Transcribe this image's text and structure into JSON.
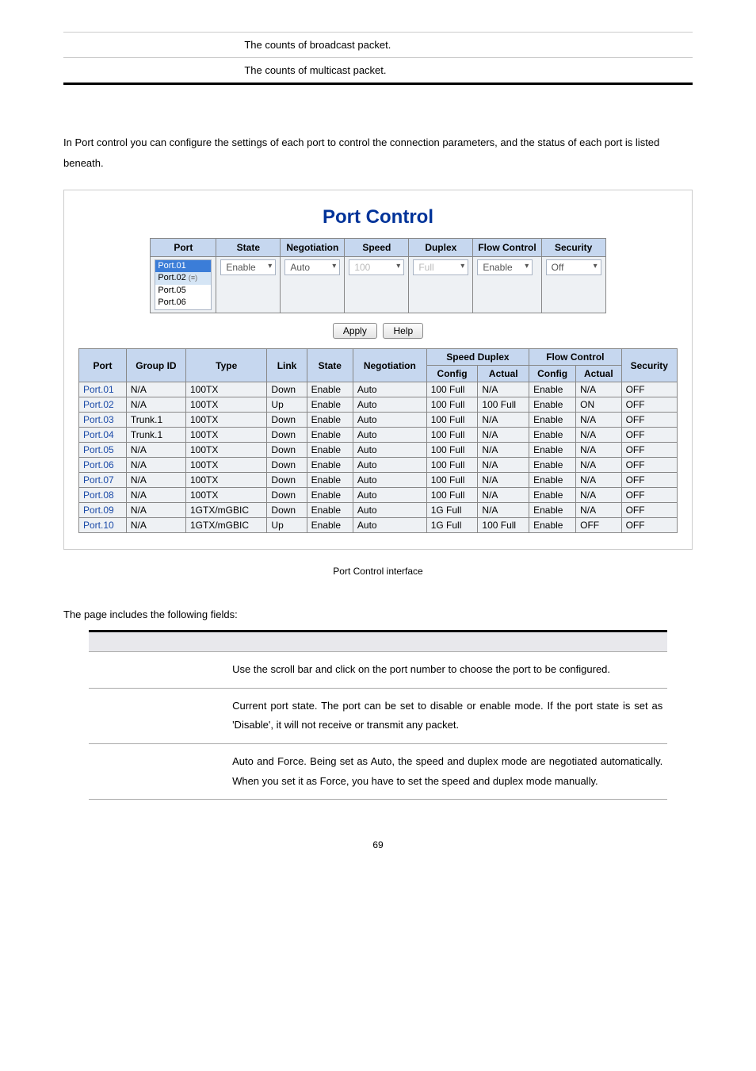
{
  "top_rows": [
    {
      "desc": "The counts of broadcast packet."
    },
    {
      "desc": "The counts of multicast packet."
    }
  ],
  "body_text": "In Port control you can configure the settings of each port to control the connection parameters, and the status of each port is listed beneath.",
  "screenshot": {
    "title": "Port Control",
    "control_headers": [
      "Port",
      "State",
      "Negotiation",
      "Speed",
      "Duplex",
      "Flow Control",
      "Security"
    ],
    "port_list": [
      "Port.01",
      "Port.02",
      "Port.05",
      "Port.06"
    ],
    "state_sel": "Enable",
    "neg_sel": "Auto",
    "speed_sel": "100",
    "duplex_sel": "Full",
    "flow_sel": "Enable",
    "sec_sel": "Off",
    "btn_apply": "Apply",
    "btn_help": "Help",
    "status_top_headers": {
      "port": "Port",
      "group": "Group ID",
      "type": "Type",
      "link": "Link",
      "state": "State",
      "neg": "Negotiation",
      "speed_duplex": "Speed Duplex",
      "flow": "Flow Control",
      "sec": "Security",
      "config": "Config",
      "actual": "Actual"
    },
    "status_rows": [
      {
        "port": "Port.01",
        "group": "N/A",
        "type": "100TX",
        "link": "Down",
        "state": "Enable",
        "neg": "Auto",
        "sd_cfg": "100 Full",
        "sd_act": "N/A",
        "fc_cfg": "Enable",
        "fc_act": "N/A",
        "sec": "OFF"
      },
      {
        "port": "Port.02",
        "group": "N/A",
        "type": "100TX",
        "link": "Up",
        "state": "Enable",
        "neg": "Auto",
        "sd_cfg": "100 Full",
        "sd_act": "100 Full",
        "fc_cfg": "Enable",
        "fc_act": "ON",
        "sec": "OFF"
      },
      {
        "port": "Port.03",
        "group": "Trunk.1",
        "type": "100TX",
        "link": "Down",
        "state": "Enable",
        "neg": "Auto",
        "sd_cfg": "100 Full",
        "sd_act": "N/A",
        "fc_cfg": "Enable",
        "fc_act": "N/A",
        "sec": "OFF"
      },
      {
        "port": "Port.04",
        "group": "Trunk.1",
        "type": "100TX",
        "link": "Down",
        "state": "Enable",
        "neg": "Auto",
        "sd_cfg": "100 Full",
        "sd_act": "N/A",
        "fc_cfg": "Enable",
        "fc_act": "N/A",
        "sec": "OFF"
      },
      {
        "port": "Port.05",
        "group": "N/A",
        "type": "100TX",
        "link": "Down",
        "state": "Enable",
        "neg": "Auto",
        "sd_cfg": "100 Full",
        "sd_act": "N/A",
        "fc_cfg": "Enable",
        "fc_act": "N/A",
        "sec": "OFF"
      },
      {
        "port": "Port.06",
        "group": "N/A",
        "type": "100TX",
        "link": "Down",
        "state": "Enable",
        "neg": "Auto",
        "sd_cfg": "100 Full",
        "sd_act": "N/A",
        "fc_cfg": "Enable",
        "fc_act": "N/A",
        "sec": "OFF"
      },
      {
        "port": "Port.07",
        "group": "N/A",
        "type": "100TX",
        "link": "Down",
        "state": "Enable",
        "neg": "Auto",
        "sd_cfg": "100 Full",
        "sd_act": "N/A",
        "fc_cfg": "Enable",
        "fc_act": "N/A",
        "sec": "OFF"
      },
      {
        "port": "Port.08",
        "group": "N/A",
        "type": "100TX",
        "link": "Down",
        "state": "Enable",
        "neg": "Auto",
        "sd_cfg": "100 Full",
        "sd_act": "N/A",
        "fc_cfg": "Enable",
        "fc_act": "N/A",
        "sec": "OFF"
      },
      {
        "port": "Port.09",
        "group": "N/A",
        "type": "1GTX/mGBIC",
        "link": "Down",
        "state": "Enable",
        "neg": "Auto",
        "sd_cfg": "1G Full",
        "sd_act": "N/A",
        "fc_cfg": "Enable",
        "fc_act": "N/A",
        "sec": "OFF"
      },
      {
        "port": "Port.10",
        "group": "N/A",
        "type": "1GTX/mGBIC",
        "link": "Up",
        "state": "Enable",
        "neg": "Auto",
        "sd_cfg": "1G Full",
        "sd_act": "100 Full",
        "fc_cfg": "Enable",
        "fc_act": "OFF",
        "sec": "OFF"
      }
    ]
  },
  "caption": "Port Control interface",
  "fields_intro": "The page includes the following fields:",
  "fields": [
    {
      "desc": "Use the scroll bar and click on the port number to choose the port to be configured."
    },
    {
      "desc": "Current port state. The port can be set to disable or enable mode. If the port state is set as 'Disable', it will not receive or transmit any packet."
    },
    {
      "desc": "Auto and Force. Being set as Auto, the speed and duplex mode are negotiated automatically. When you set it as Force, you have to set the speed and duplex mode manually."
    }
  ],
  "page_number": "69"
}
